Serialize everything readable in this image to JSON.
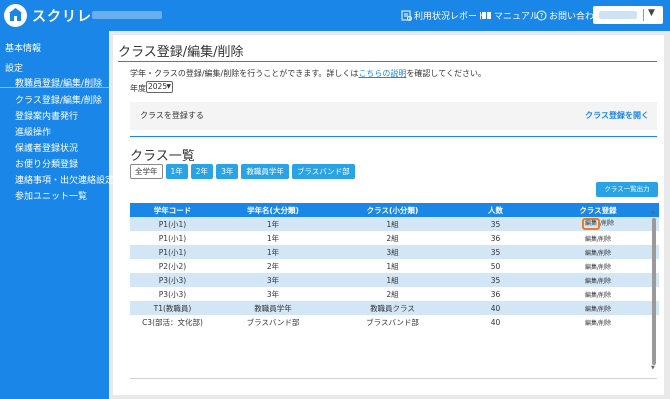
{
  "header": {
    "app_name": "スクリレ",
    "usage_report": "利用状況レポート",
    "manual": "マニュアル",
    "contact": "お問い合わせ"
  },
  "sidebar": {
    "basic_info": "基本情報",
    "settings": "設定",
    "items": [
      "教職員登録/編集/削除",
      "クラス登録/編集/削除",
      "登録案内書発行",
      "進級操作",
      "保護者登録状況",
      "お便り分類登録",
      "連絡事項・出欠連絡設定",
      "参加ユニット一覧"
    ]
  },
  "main": {
    "title": "クラス登録/編集/削除",
    "desc_before": "学年・クラスの登録/編集/削除を行うことができます。詳しくは",
    "desc_link": "こちらの説明",
    "desc_after": "を確認してください。",
    "year_label": "年度",
    "year_value": "2025",
    "register_label": "クラスを登録する",
    "register_open": "クラス登録を開く",
    "list_title": "クラス一覧",
    "filters": [
      "全学年",
      "1年",
      "2年",
      "3年",
      "教職員学年",
      "ブラスバンド部"
    ],
    "active_filter": 0,
    "export": "クラス一覧出力"
  },
  "table": {
    "headers": [
      "学年コード",
      "学年名(大分類)",
      "クラス(小分類)",
      "人数",
      "クラス登録"
    ],
    "edit_label": "編集",
    "delete_label": "削除",
    "rows": [
      [
        "P1(小1)",
        "1年",
        "1組",
        "35"
      ],
      [
        "P1(小1)",
        "1年",
        "2組",
        "36"
      ],
      [
        "P1(小1)",
        "1年",
        "3組",
        "35"
      ],
      [
        "P2(小2)",
        "2年",
        "1組",
        "50"
      ],
      [
        "P3(小3)",
        "3年",
        "1組",
        "35"
      ],
      [
        "P3(小3)",
        "3年",
        "2組",
        "36"
      ],
      [
        "T1(教職員)",
        "教職員学年",
        "教職員クラス",
        "40"
      ],
      [
        "C3(部活：文化部)",
        "ブラスバンド部",
        "ブラスバンド部",
        "40"
      ]
    ]
  },
  "colors": {
    "brand": "#1a86e8",
    "button": "#29a3e5",
    "row_alt": "#d3e6f6",
    "highlight": "#f07a1d"
  }
}
